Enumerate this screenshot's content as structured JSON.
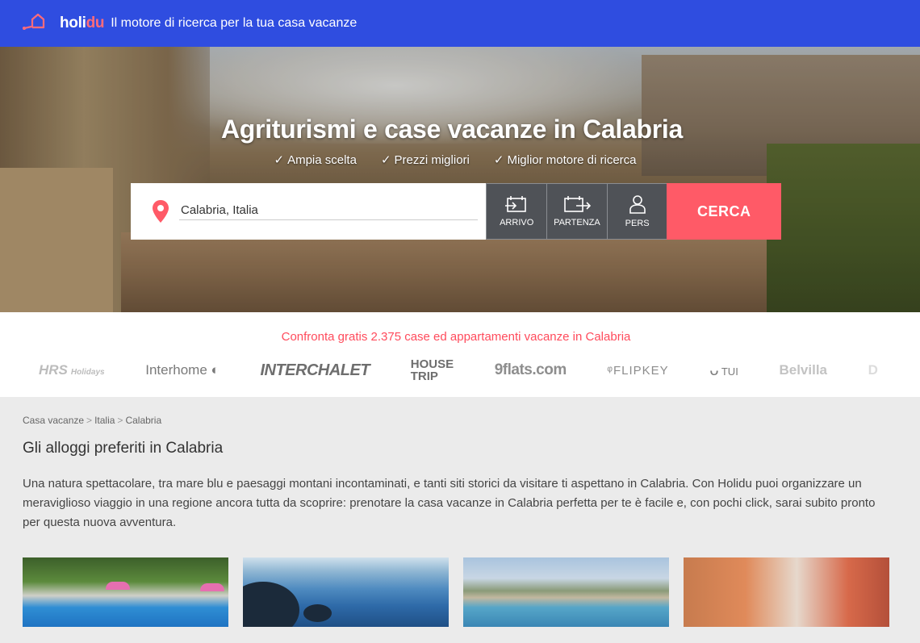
{
  "header": {
    "logo_part1": "holi",
    "logo_part2": "du",
    "tagline": "Il motore di ricerca per la tua casa vacanze",
    "brand_color": "#2f4de0"
  },
  "hero": {
    "title": "Agriturismi e case vacanze in Calabria",
    "checks": [
      "Ampia scelta",
      "Prezzi migliori",
      "Miglior motore di ricerca"
    ],
    "check_glyph": "✓"
  },
  "search": {
    "location_value": "Calabria, Italia",
    "location_icon": "map-pin-icon",
    "arrival_label": "ARRIVO",
    "departure_label": "PARTENZA",
    "guests_label": "PERS",
    "submit_label": "CERCA",
    "submit_color": "#ff5a67"
  },
  "partners": {
    "compare_text": "Confronta gratis 2.375 case ed appartamenti vacanze in Calabria",
    "logos": {
      "hrs": "HRS",
      "hrs_sub": "Holidays",
      "interhome": "Interhome",
      "interchalet": "INTERCHALET",
      "housetrip_1": "HOUSE",
      "housetrip_2": "TRIP",
      "nineflats": "9flats.com",
      "flipkey": "FLIPKEY",
      "tui": "TUI",
      "belvilla": "Belvilla",
      "d": "D"
    }
  },
  "breadcrumb": {
    "items": [
      "Casa vacanze",
      "Italia",
      "Calabria"
    ],
    "separator": ">"
  },
  "section": {
    "heading": "Gli alloggi preferiti in Calabria",
    "description": "Una natura spettacolare, tra mare blu e paesaggi montani incontaminati, e tanti siti storici da visitare ti aspettano in Calabria. Con Holidu puoi organizzare un meraviglioso viaggio in una regione ancora tutta da scoprire: prenotare la casa vacanze in Calabria perfetta per te è facile e, con pochi click, sarai subito pronto per questa nuova avventura."
  }
}
